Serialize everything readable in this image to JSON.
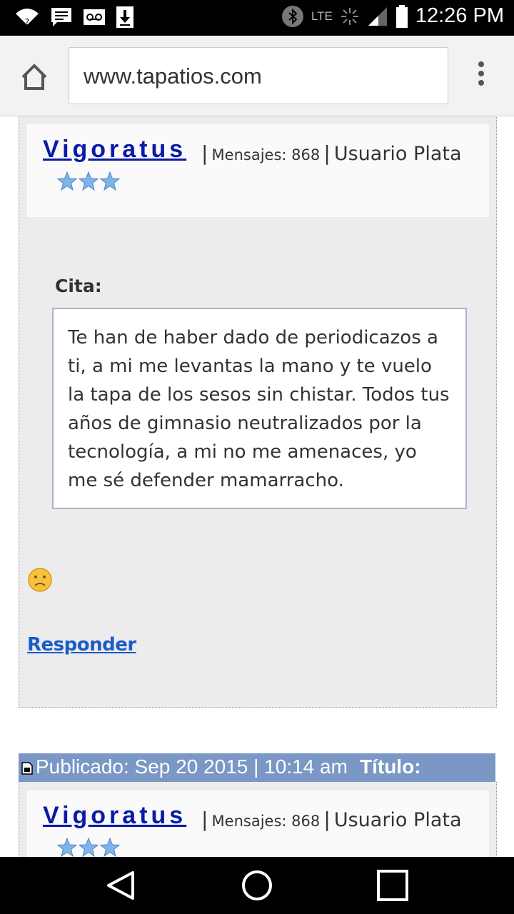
{
  "status_bar": {
    "time": "12:26 PM",
    "network": "LTE",
    "icons": [
      "wifi-icon",
      "message-icon",
      "voicemail-icon",
      "download-icon",
      "bluetooth-icon",
      "signal-icon",
      "battery-icon"
    ]
  },
  "browser": {
    "url": "www.tapatios.com"
  },
  "post1": {
    "username": "Vigoratus",
    "separator": "|",
    "messages_label": "Mensajes: 868",
    "rank": "Usuario Plata",
    "stars": 3,
    "quote_label": "Cita:",
    "quote_text": "Te han de haber dado de periodicazos a ti, a mi me levantas la mano y te vuelo la tapa de los sesos sin chistar. Todos tus años de gimnasio neutralizados por la tecnología, a mi no me amenaces, yo me sé defender mamarracho.",
    "reply": "Responder"
  },
  "post2": {
    "published": "Publicado: Sep 20 2015 | 10:14 am",
    "title_label": "Título:",
    "username": "Vigoratus",
    "separator": "|",
    "messages_label": "Mensajes: 868",
    "rank": "Usuario Plata",
    "stars": 3
  },
  "colors": {
    "username": "#0a1aa8",
    "link": "#1a5cc8",
    "post_header": "#7a97c6",
    "post_bg": "#ececec"
  }
}
